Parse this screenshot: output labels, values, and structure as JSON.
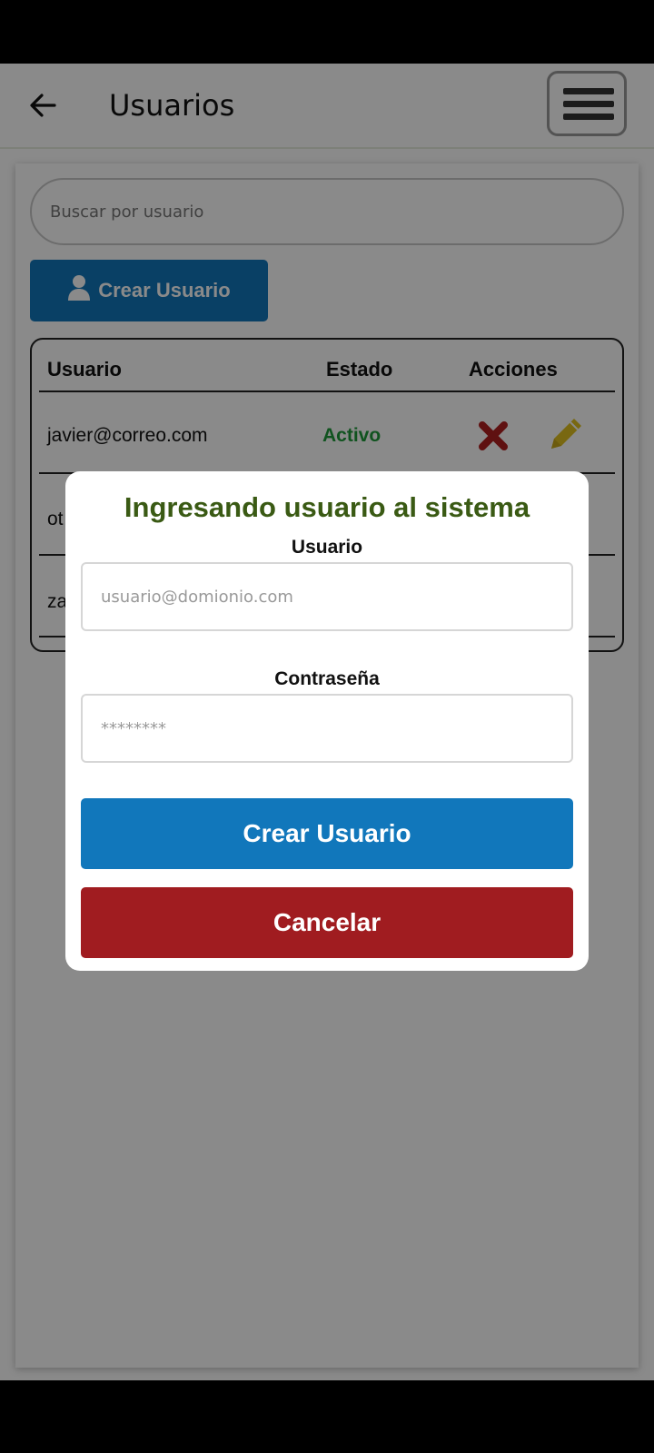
{
  "header": {
    "title": "Usuarios"
  },
  "search": {
    "placeholder": "Buscar por usuario"
  },
  "create_button": {
    "label": "Crear Usuario"
  },
  "table": {
    "columns": [
      "Usuario",
      "Estado",
      "Acciones"
    ],
    "rows": [
      {
        "user": "javier@correo.com",
        "status": "Activo"
      },
      {
        "user": "ot"
      },
      {
        "user": "za"
      }
    ]
  },
  "modal": {
    "title": "Ingresando usuario al sistema",
    "user_label": "Usuario",
    "user_placeholder": "usuario@domionio.com",
    "password_label": "Contraseña",
    "password_placeholder": "********",
    "submit_label": "Crear Usuario",
    "cancel_label": "Cancelar"
  },
  "colors": {
    "primary": "#1177bb",
    "danger": "#a01c20",
    "active_status": "#1f9a3a",
    "modal_title": "#3a5a14",
    "edit_icon": "#e0c020",
    "delete_icon": "#b02020"
  }
}
